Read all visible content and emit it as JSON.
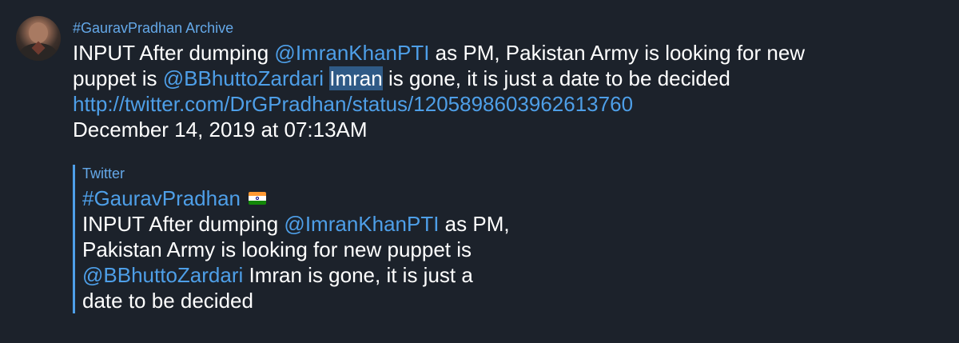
{
  "sender": {
    "name": "#GauravPradhan Archive"
  },
  "message": {
    "line1_prefix": "INPUT After dumping ",
    "mention1": "@ImranKhanPTI",
    "line1_suffix": " as PM, Pakistan Army is looking for new",
    "line2_prefix": "puppet is ",
    "mention2": "@BBhuttoZardari",
    "line2_space": " ",
    "highlighted_word": "Imran",
    "line2_suffix": " is gone, it is just a date to be decided",
    "link": "http://twitter.com/DrGPradhan/status/1205898603962613760",
    "date": "December 14, 2019 at 07:13AM"
  },
  "quote": {
    "source": "Twitter",
    "title": "#GauravPradhan",
    "flag_icon": "india-flag-icon",
    "line1_prefix": "INPUT After dumping ",
    "mention1": "@ImranKhanPTI",
    "line1_suffix": " as PM,",
    "line2": "Pakistan Army is looking for new puppet is",
    "mention2": "@BBhuttoZardari",
    "line3_suffix": " Imran is gone, it is just a",
    "line4": "date to be decided"
  },
  "colors": {
    "background": "#1c222b",
    "accent": "#4e9fe8",
    "sender": "#64a8e8",
    "highlight": "#2f5a86",
    "text": "#ffffff"
  }
}
